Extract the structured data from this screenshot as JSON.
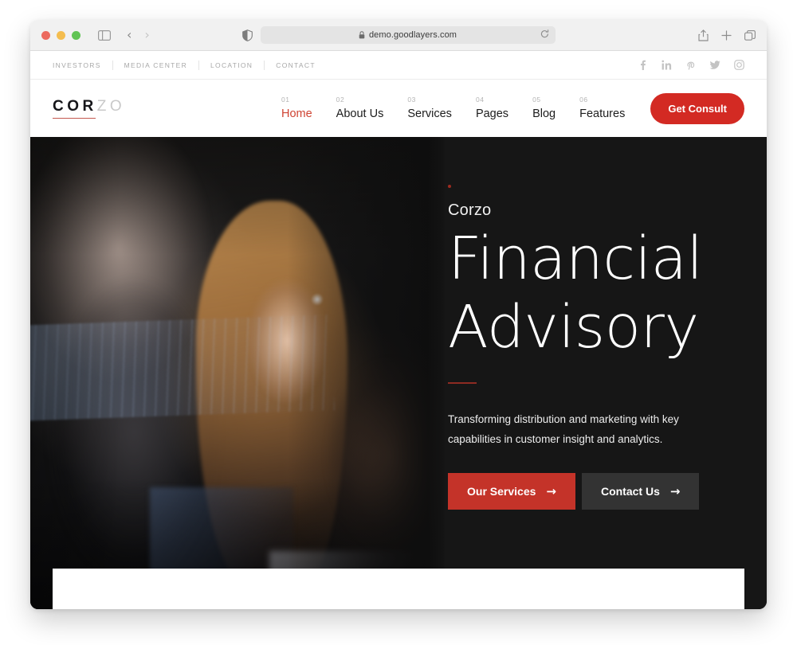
{
  "browser": {
    "url": "demo.goodlayers.com",
    "lock_icon": "lock-icon",
    "shield_icon": "shield-icon",
    "reload_icon": "reload-icon",
    "sidebar_icon": "sidebar-toggle-icon",
    "back_icon": "‹",
    "forward_icon": "›",
    "share_icon": "share-icon",
    "newtab_icon": "plus-icon",
    "tabs_icon": "tabs-overview-icon"
  },
  "topbar": {
    "links": [
      {
        "label": "INVESTORS"
      },
      {
        "label": "MEDIA CENTER"
      },
      {
        "label": "LOCATION"
      },
      {
        "label": "CONTACT"
      }
    ],
    "social": [
      {
        "name": "facebook-icon",
        "glyph": "f"
      },
      {
        "name": "linkedin-icon",
        "glyph": "in"
      },
      {
        "name": "pinterest-icon",
        "glyph": "P"
      },
      {
        "name": "twitter-icon",
        "glyph": "ᴠ"
      },
      {
        "name": "instagram-icon",
        "glyph": "▢"
      }
    ]
  },
  "header": {
    "logo": {
      "bold": "COR",
      "light": "ZO"
    },
    "nav": [
      {
        "num": "01",
        "label": "Home",
        "active": true
      },
      {
        "num": "02",
        "label": "About Us",
        "active": false
      },
      {
        "num": "03",
        "label": "Services",
        "active": false
      },
      {
        "num": "04",
        "label": "Pages",
        "active": false
      },
      {
        "num": "05",
        "label": "Blog",
        "active": false
      },
      {
        "num": "06",
        "label": "Features",
        "active": false
      }
    ],
    "cta_label": "Get Consult"
  },
  "hero": {
    "eyebrow": "Corzo",
    "title_line1": "Financial",
    "title_line2": "Advisory",
    "subtitle": "Transforming distribution and marketing with key capabilities in customer insight and analytics.",
    "primary_button": "Our Services",
    "secondary_button": "Contact Us",
    "arrow_glyph": "→"
  },
  "colors": {
    "brand_red": "#d32a23",
    "accent_red": "#cf4332",
    "hero_button_red": "#c43329",
    "hero_button_dark": "#333333",
    "hero_background": "#161616",
    "logo_underline": "#c4584f"
  }
}
